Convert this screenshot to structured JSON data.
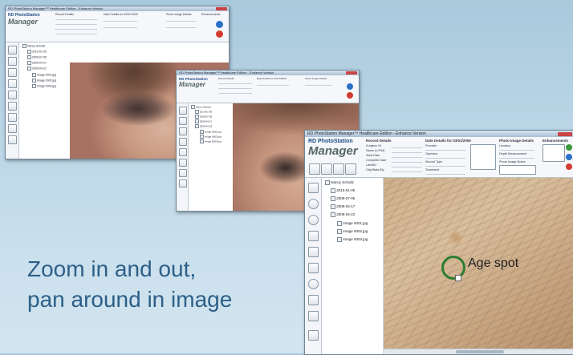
{
  "caption": {
    "line1": "Zoom in and out,",
    "line2": "pan around in image"
  },
  "app": {
    "window_title": "RD PhotoStation Manager™ Healthcare Edition - Enhance Version",
    "logo_small": "RD PhotoStation",
    "logo_big": "Manager",
    "section_record": "Record Details",
    "section_visit": "Date Details for 03/01/2009",
    "section_photo": "Photo Image Details",
    "section_enhance": "Enhancements",
    "tree_root": "Nancy Schultz",
    "tree_dates": [
      "2010-01-05",
      "2009-07-05",
      "2009-04-17",
      "2009-04-22"
    ],
    "tree_images": [
      "Image 0001.jpg",
      "Image 0002.jpg",
      "Image 0003.jpg"
    ],
    "field_labels": [
      "Surgeon ID",
      "Name (L/F/M)",
      "Start Date",
      "Complete Date",
      "LabelID",
      "City/State/Zip"
    ],
    "visit_labels": [
      "Provider",
      "Operator",
      "Wound Type",
      "Treatment"
    ],
    "photo_labels": [
      "Location",
      "Depth Measurement",
      "Photo Image Notes"
    ]
  },
  "annotation": {
    "label": "Age spot"
  },
  "colors": {
    "caption": "#2c5f88",
    "marker": "#2e7d32"
  }
}
